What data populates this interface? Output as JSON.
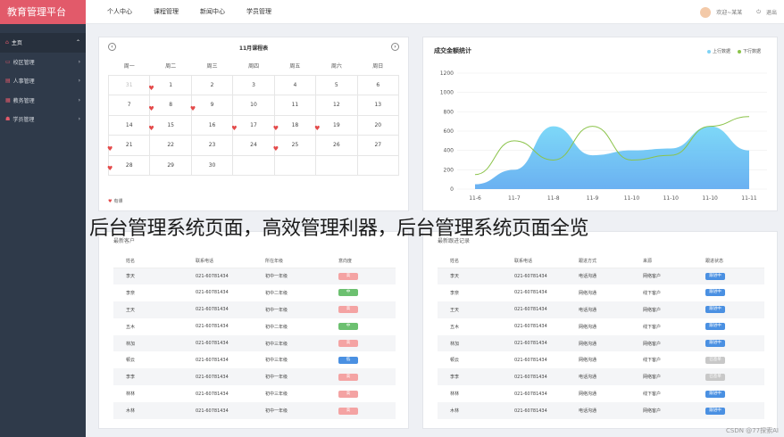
{
  "app_title": "教育管理平台",
  "sidebar": {
    "items": [
      {
        "label": "主页",
        "icon": "home-icon"
      },
      {
        "label": "校区管理",
        "icon": "campus-icon"
      },
      {
        "label": "人事管理",
        "icon": "staff-icon"
      },
      {
        "label": "教务管理",
        "icon": "academic-icon"
      },
      {
        "label": "学员管理",
        "icon": "student-icon"
      }
    ]
  },
  "topnav": [
    "个人中心",
    "课程管理",
    "新闻中心",
    "学员管理"
  ],
  "user": {
    "greeting": "欢迎~某某",
    "logout": "退出"
  },
  "calendar": {
    "title": "11月课程表",
    "weekdays": [
      "周一",
      "周二",
      "周三",
      "周四",
      "周五",
      "周六",
      "周日"
    ],
    "weeks": [
      [
        "31",
        "1",
        "2",
        "3",
        "4",
        "5",
        "6"
      ],
      [
        "7",
        "8",
        "9",
        "10",
        "11",
        "12",
        "13"
      ],
      [
        "14",
        "15",
        "16",
        "17",
        "18",
        "19",
        "20"
      ],
      [
        "21",
        "22",
        "23",
        "24",
        "25",
        "26",
        "27"
      ],
      [
        "28",
        "29",
        "30",
        "",
        "",
        "",
        ""
      ]
    ],
    "legend": "有课"
  },
  "chart_data": {
    "type": "area",
    "title": "成交金额统计",
    "categories": [
      "11-6",
      "11-7",
      "11-8",
      "11-9",
      "11-10",
      "11-10",
      "11-10",
      "11-11"
    ],
    "ylim": [
      0,
      1200
    ],
    "yticks": [
      0,
      200,
      400,
      600,
      800,
      1000,
      1200
    ],
    "series": [
      {
        "name": "上行数据",
        "color": "#7fd3f5",
        "values": [
          50,
          200,
          650,
          350,
          400,
          420,
          650,
          400
        ]
      },
      {
        "name": "下行数据",
        "color": "#8bc34a",
        "values": [
          150,
          500,
          300,
          650,
          300,
          350,
          650,
          750
        ]
      }
    ]
  },
  "table1": {
    "title": "最新客户",
    "headers": [
      "姓名",
      "联系电话",
      "所在年级",
      "意向度"
    ],
    "rows": [
      [
        "李天",
        "021-60781434",
        "初中一年级",
        "高"
      ],
      [
        "李奈",
        "021-60781434",
        "初中二年级",
        "中"
      ],
      [
        "王天",
        "021-60781434",
        "初中一年级",
        "高"
      ],
      [
        "五木",
        "021-60781434",
        "初中二年级",
        "中"
      ],
      [
        "林加",
        "021-60781434",
        "初中三年级",
        "高"
      ],
      [
        "顿云",
        "021-60781434",
        "初中三年级",
        "低"
      ],
      [
        "李李",
        "021-60781434",
        "初中一年级",
        "高"
      ],
      [
        "林林",
        "021-60781434",
        "初中三年级",
        "高"
      ],
      [
        "木林",
        "021-60781434",
        "初中一年级",
        "高"
      ]
    ]
  },
  "table2": {
    "title": "最新跟进记录",
    "headers": [
      "姓名",
      "联系电话",
      "跟进方式",
      "来源",
      "跟进状态"
    ],
    "rows": [
      [
        "李天",
        "021-60781434",
        "电话沟通",
        "网络客户",
        "跟进中"
      ],
      [
        "李奈",
        "021-60781434",
        "网络沟通",
        "线下客户",
        "跟进中"
      ],
      [
        "王天",
        "021-60781434",
        "电话沟通",
        "网络客户",
        "跟进中"
      ],
      [
        "五木",
        "021-60781434",
        "网络沟通",
        "线下客户",
        "跟进中"
      ],
      [
        "林加",
        "021-60781434",
        "网络沟通",
        "网络客户",
        "跟进中"
      ],
      [
        "顿云",
        "021-60781434",
        "网络沟通",
        "线下客户",
        "已签单"
      ],
      [
        "李李",
        "021-60781434",
        "电话沟通",
        "网络客户",
        "已签单"
      ],
      [
        "林林",
        "021-60781434",
        "网络沟通",
        "线下客户",
        "跟进中"
      ],
      [
        "木林",
        "021-60781434",
        "电话沟通",
        "网络客户",
        "跟进中"
      ]
    ]
  },
  "colors": {
    "high": "#f4a3a3",
    "mid": "#6cc070",
    "low": "#4a90e2",
    "following": "#4a90e2",
    "signed": "#c8c8c8"
  },
  "overlay_text": "后台管理系统页面，高效管理利器，后台管理系统页面全览",
  "watermark": "CSDN @77探索AI"
}
